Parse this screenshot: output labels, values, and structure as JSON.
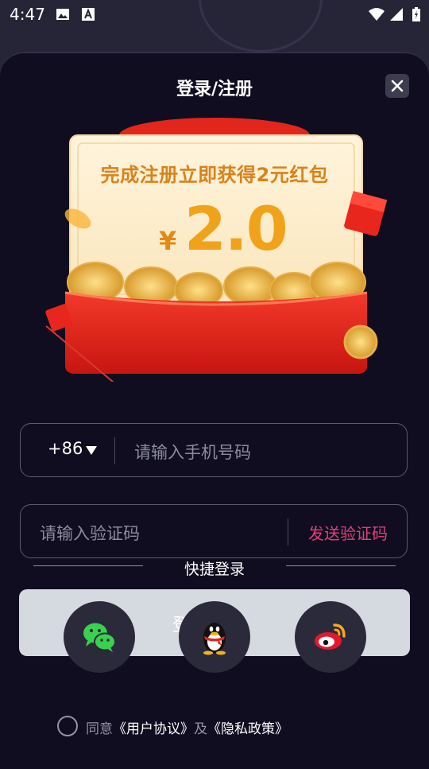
{
  "status_bar": {
    "time": "4:47"
  },
  "dialog": {
    "title": "登录/注册"
  },
  "promo": {
    "headline": "完成注册立即获得2元红包",
    "currency": "¥",
    "amount": "2.0"
  },
  "phone": {
    "country_code": "+86",
    "placeholder": "请输入手机号码"
  },
  "code": {
    "placeholder": "请输入验证码",
    "send_label": "发送验证码"
  },
  "login": {
    "label": "登录"
  },
  "quick_login": {
    "title": "快捷登录",
    "providers": [
      {
        "name": "wechat-icon"
      },
      {
        "name": "qq-icon"
      },
      {
        "name": "weibo-icon"
      }
    ]
  },
  "agreement": {
    "prefix": "同意",
    "user_agreement": "《用户协议》",
    "and": "及",
    "privacy": "《隐私政策》"
  },
  "colors": {
    "background": "#0f0d1f",
    "accent": "#e0407a",
    "gold": "#f0a31a",
    "red": "#e32a20"
  }
}
